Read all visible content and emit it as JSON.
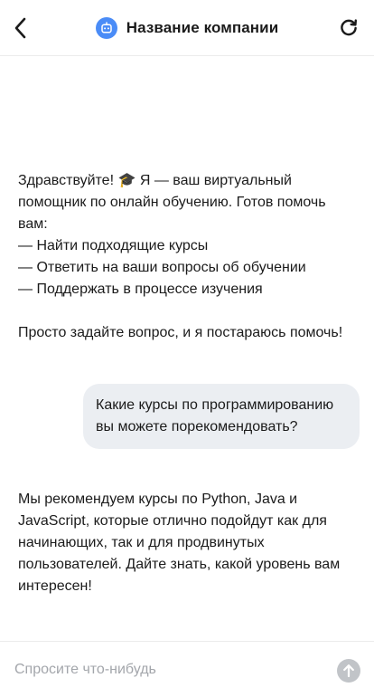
{
  "header": {
    "title": "Название компании",
    "back_icon": "chevron-left-icon",
    "refresh_icon": "refresh-icon",
    "avatar_icon": "robot-icon",
    "avatar_color": "#4a8cf7"
  },
  "messages": [
    {
      "role": "bot",
      "text": "Здравствуйте! 🎓 Я — ваш виртуальный помощник по онлайн обучению. Готов помочь вам:\n— Найти подходящие курсы\n— Ответить на ваши вопросы об обучении\n— Поддержать в процессе изучения\n\nПросто задайте вопрос, и я постараюсь помочь!"
    },
    {
      "role": "user",
      "text": "Какие курсы по программированию вы можете порекомендовать?"
    },
    {
      "role": "bot",
      "text": "Мы рекомендуем курсы по Python, Java и JavaScript, которые отлично подойдут как для начинающих, так и для продвинутых пользователей. Дайте знать, какой уровень вам интересен!"
    }
  ],
  "composer": {
    "placeholder": "Спросите что-нибудь",
    "send_icon": "arrow-up-icon"
  },
  "colors": {
    "user_bubble": "#ebeef2",
    "send_button": "#c1c4c8",
    "divider": "#ececec"
  }
}
